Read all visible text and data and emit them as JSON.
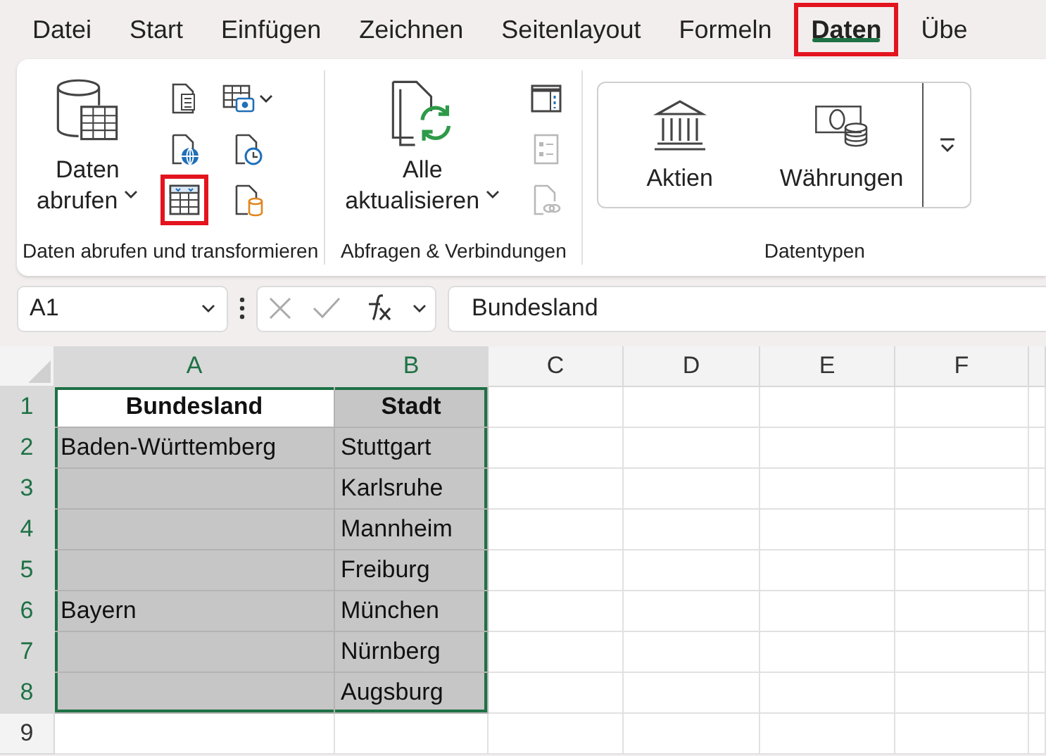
{
  "menu_tabs": [
    {
      "label": "Datei",
      "selected": false,
      "highlighted": false
    },
    {
      "label": "Start",
      "selected": false,
      "highlighted": false
    },
    {
      "label": "Einfügen",
      "selected": false,
      "highlighted": false
    },
    {
      "label": "Zeichnen",
      "selected": false,
      "highlighted": false
    },
    {
      "label": "Seitenlayout",
      "selected": false,
      "highlighted": false
    },
    {
      "label": "Formeln",
      "selected": false,
      "highlighted": false
    },
    {
      "label": "Daten",
      "selected": true,
      "highlighted": true
    },
    {
      "label": "Übe",
      "selected": false,
      "highlighted": false
    }
  ],
  "ribbon": {
    "groups": [
      {
        "label": "Daten abrufen und transformieren",
        "large_button": {
          "lines": [
            "Daten",
            "abrufen"
          ],
          "dropdown": true
        },
        "small_buttons": [
          {
            "highlighted": false,
            "disabled": false
          },
          {
            "highlighted": false,
            "disabled": false
          },
          {
            "highlighted": true,
            "disabled": false
          },
          {
            "highlighted": false,
            "disabled": false,
            "dropdown": true
          },
          {
            "highlighted": false,
            "disabled": false
          },
          {
            "highlighted": false,
            "disabled": false
          }
        ]
      },
      {
        "label": "Abfragen & Verbindungen",
        "large_button": {
          "lines": [
            "Alle",
            "aktualisieren"
          ],
          "dropdown": true
        },
        "small_buttons": [
          {
            "highlighted": false,
            "disabled": false
          },
          {
            "highlighted": false,
            "disabled": true
          },
          {
            "highlighted": false,
            "disabled": true
          }
        ]
      },
      {
        "label": "Datentypen",
        "gallery": [
          {
            "label": "Aktien"
          },
          {
            "label": "Währungen"
          }
        ]
      }
    ]
  },
  "formula_bar": {
    "name_box": "A1",
    "formula": "Bundesland"
  },
  "sheet": {
    "columns": [
      {
        "label": "A",
        "selected": true
      },
      {
        "label": "B",
        "selected": true
      },
      {
        "label": "C",
        "selected": false
      },
      {
        "label": "D",
        "selected": false
      },
      {
        "label": "E",
        "selected": false
      },
      {
        "label": "F",
        "selected": false
      }
    ],
    "rows": [
      {
        "header": "1",
        "selected": true,
        "cells": [
          {
            "kind": "header",
            "text": "Bundesland",
            "selected": true,
            "active": true
          },
          {
            "kind": "header",
            "text": "Stadt",
            "selected": true,
            "active": false
          }
        ]
      },
      {
        "header": "2",
        "selected": true,
        "cells": [
          {
            "kind": "text",
            "text": "Baden-Württemberg",
            "selected": true,
            "active": false
          },
          {
            "kind": "text",
            "text": "Stuttgart",
            "selected": true,
            "active": false
          }
        ]
      },
      {
        "header": "3",
        "selected": true,
        "cells": [
          {
            "kind": "text",
            "selected": true,
            "active": false
          },
          {
            "kind": "text",
            "text": "Karlsruhe",
            "selected": true,
            "active": false
          }
        ]
      },
      {
        "header": "4",
        "selected": true,
        "cells": [
          {
            "kind": "text",
            "selected": true,
            "active": false
          },
          {
            "kind": "text",
            "text": "Mannheim",
            "selected": true,
            "active": false
          }
        ]
      },
      {
        "header": "5",
        "selected": true,
        "cells": [
          {
            "kind": "text",
            "selected": true,
            "active": false
          },
          {
            "kind": "text",
            "text": "Freiburg",
            "selected": true,
            "active": false
          }
        ]
      },
      {
        "header": "6",
        "selected": true,
        "cells": [
          {
            "kind": "text",
            "text": "Bayern",
            "selected": true,
            "active": false
          },
          {
            "kind": "text",
            "text": "München",
            "selected": true,
            "active": false
          }
        ]
      },
      {
        "header": "7",
        "selected": true,
        "cells": [
          {
            "kind": "text",
            "selected": true,
            "active": false
          },
          {
            "kind": "text",
            "text": "Nürnberg",
            "selected": true,
            "active": false
          }
        ]
      },
      {
        "header": "8",
        "selected": true,
        "cells": [
          {
            "kind": "text",
            "selected": true,
            "active": false
          },
          {
            "kind": "text",
            "text": "Augsburg",
            "selected": true,
            "active": false
          }
        ]
      },
      {
        "header": "9",
        "selected": false
      }
    ]
  }
}
